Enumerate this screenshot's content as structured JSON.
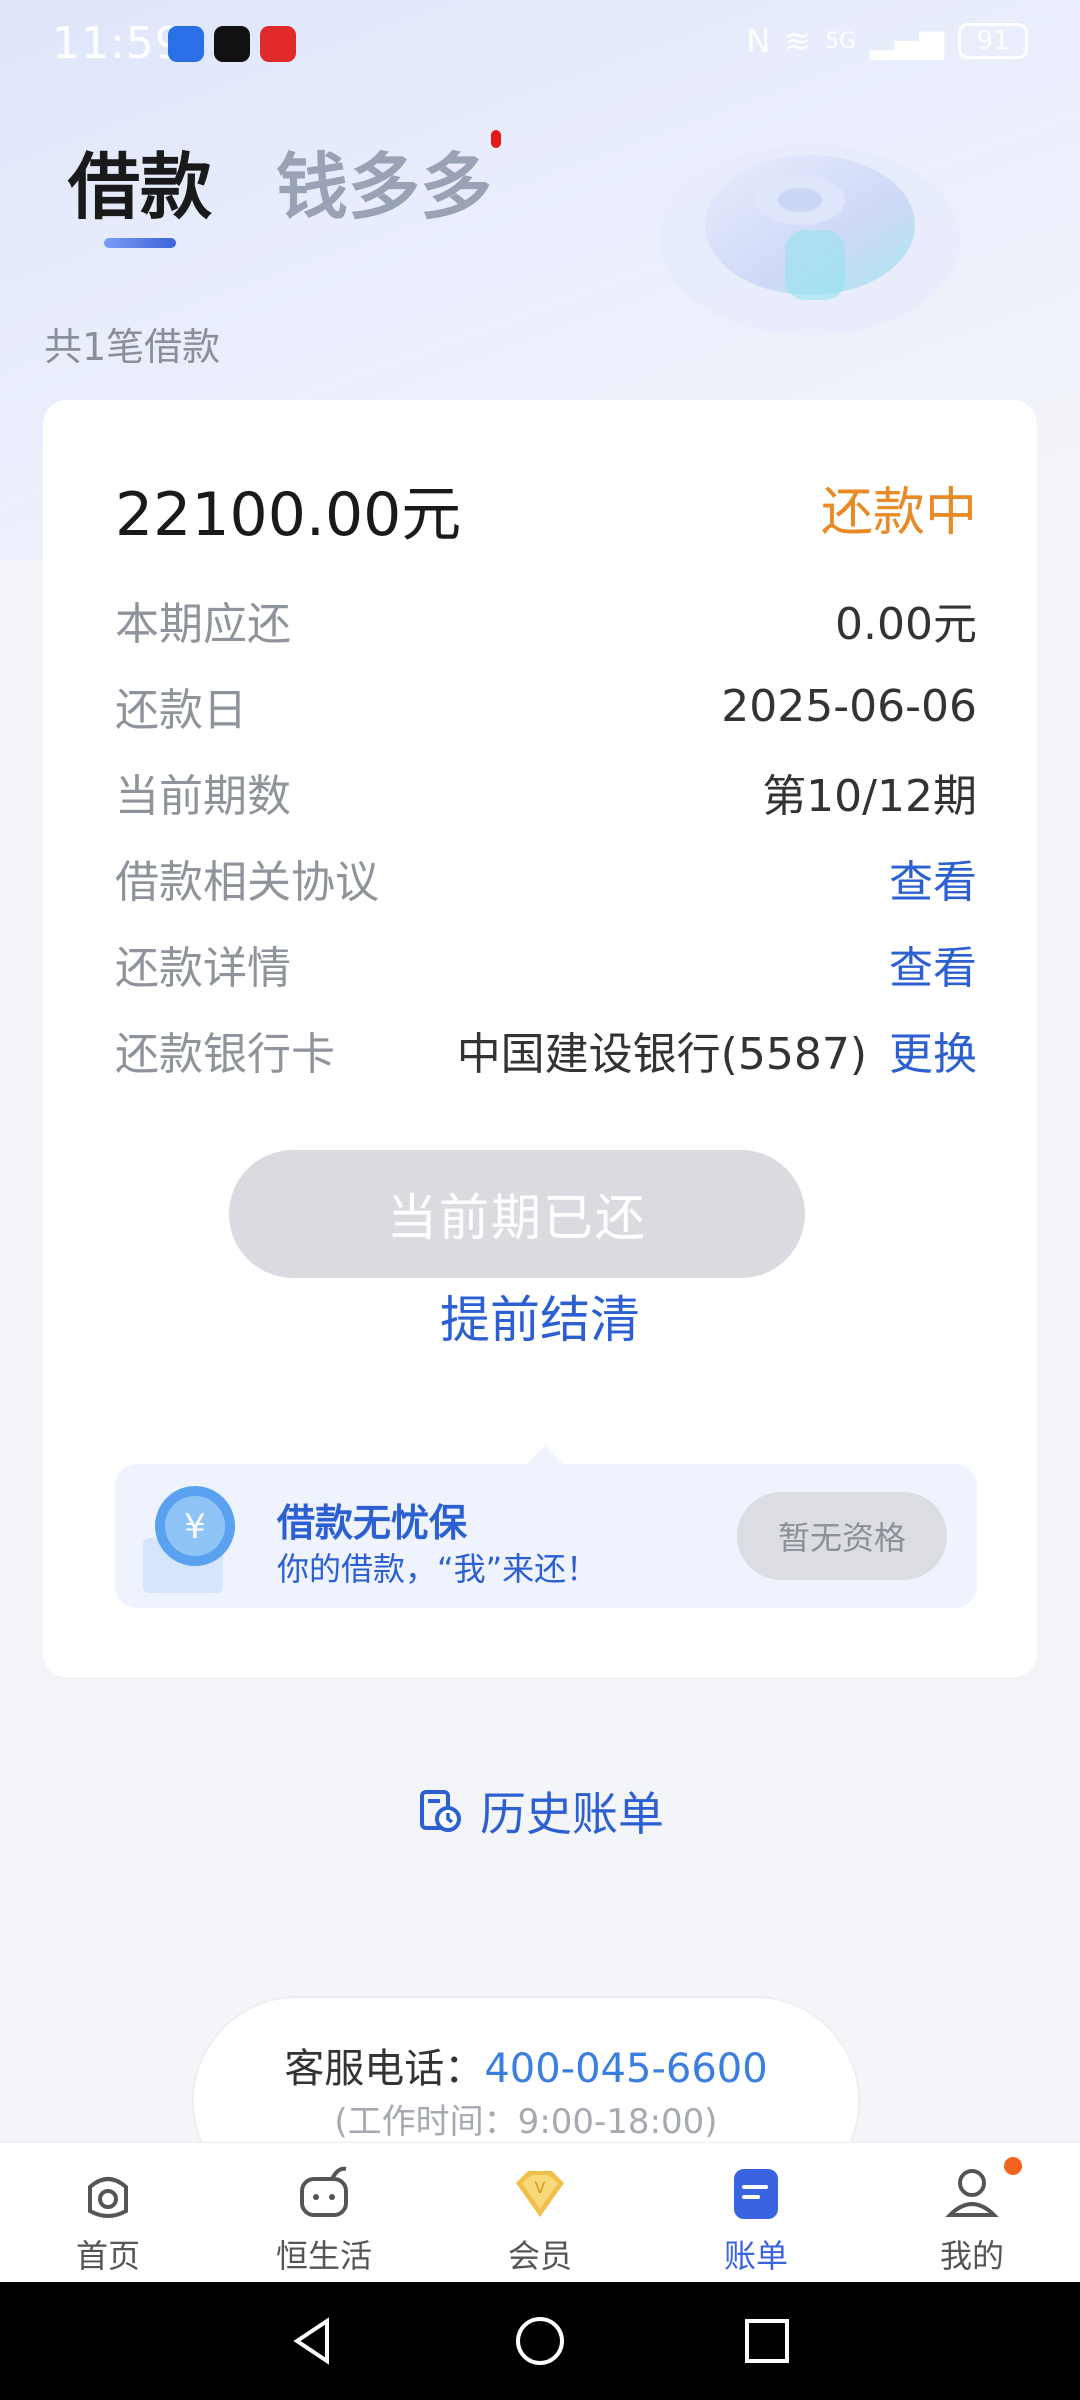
{
  "status_bar": {
    "time": "11:59",
    "battery": "91",
    "network": "5G"
  },
  "tabs": {
    "active": "借款",
    "inactive": "钱多多"
  },
  "loan_count_text": "共1笔借款",
  "loan": {
    "amount": "22100.00元",
    "status": "还款中",
    "rows": [
      {
        "label": "本期应还",
        "value": "0.00元"
      },
      {
        "label": "还款日",
        "value": "2025-06-06"
      },
      {
        "label": "当前期数",
        "value": "第10/12期"
      },
      {
        "label": "借款相关协议",
        "value": "查看"
      },
      {
        "label": "还款详情",
        "value": "查看"
      },
      {
        "label": "还款银行卡",
        "value": "中国建设银行(5587)",
        "action": "更换"
      }
    ],
    "paid_button": "当前期已还",
    "early_settle": "提前结清"
  },
  "insurance": {
    "title": "借款无忧保",
    "subtitle": "你的借款，“我”来还！",
    "button": "暂无资格"
  },
  "history_label": "历史账单",
  "service": {
    "label": "客服电话：",
    "phone": "400-045-6600",
    "hours": "(工作时间：9:00-18:00)"
  },
  "bottom_nav": [
    {
      "label": "首页",
      "icon": "home-icon"
    },
    {
      "label": "恒生活",
      "icon": "life-icon"
    },
    {
      "label": "会员",
      "icon": "vip-icon"
    },
    {
      "label": "账单",
      "icon": "bill-icon"
    },
    {
      "label": "我的",
      "icon": "profile-icon"
    }
  ],
  "colors": {
    "accent": "#2c5fd2",
    "status_orange": "#e88a26",
    "nav_active": "#3a63e0",
    "phone": "#3a7ee0"
  }
}
